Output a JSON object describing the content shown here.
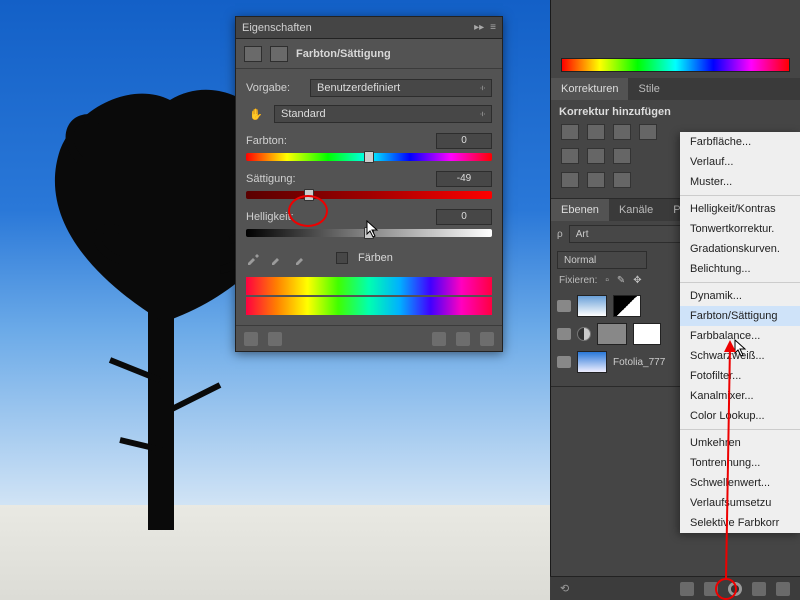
{
  "propPanel": {
    "title": "Eigenschaften",
    "subtitle": "Farbton/Sättigung",
    "presetLabel": "Vorgabe:",
    "presetValue": "Benutzerdefiniert",
    "channelValue": "Standard",
    "hueLabel": "Farbton:",
    "hueValue": "0",
    "satLabel": "Sättigung:",
    "satValue": "-49",
    "ligLabel": "Helligkeit:",
    "ligValue": "0",
    "colorizeLabel": "Färben"
  },
  "korr": {
    "tab1": "Korrekturen",
    "tab2": "Stile",
    "addLabel": "Korrektur hinzufügen"
  },
  "layers": {
    "tab1": "Ebenen",
    "tab2": "Kanäle",
    "tab3": "Pfad",
    "kindLabel": "Art",
    "blendMode": "Normal",
    "lockLabel": "Fixieren:",
    "layer3": "Fotolia_777"
  },
  "menu": {
    "i1": "Farbfläche...",
    "i2": "Verlauf...",
    "i3": "Muster...",
    "i4": "Helligkeit/Kontras",
    "i5": "Tonwertkorrektur.",
    "i6": "Gradationskurven.",
    "i7": "Belichtung...",
    "i8": "Dynamik...",
    "i9": "Farbton/Sättigung",
    "i10": "Farbbalance...",
    "i11": "Schwarzweiß...",
    "i12": "Fotofilter...",
    "i13": "Kanalmixer...",
    "i14": "Color Lookup...",
    "i15": "Umkehren",
    "i16": "Tontrennung...",
    "i17": "Schwellenwert...",
    "i18": "Verlaufsumsetzu",
    "i19": "Selektive Farbkorr"
  }
}
